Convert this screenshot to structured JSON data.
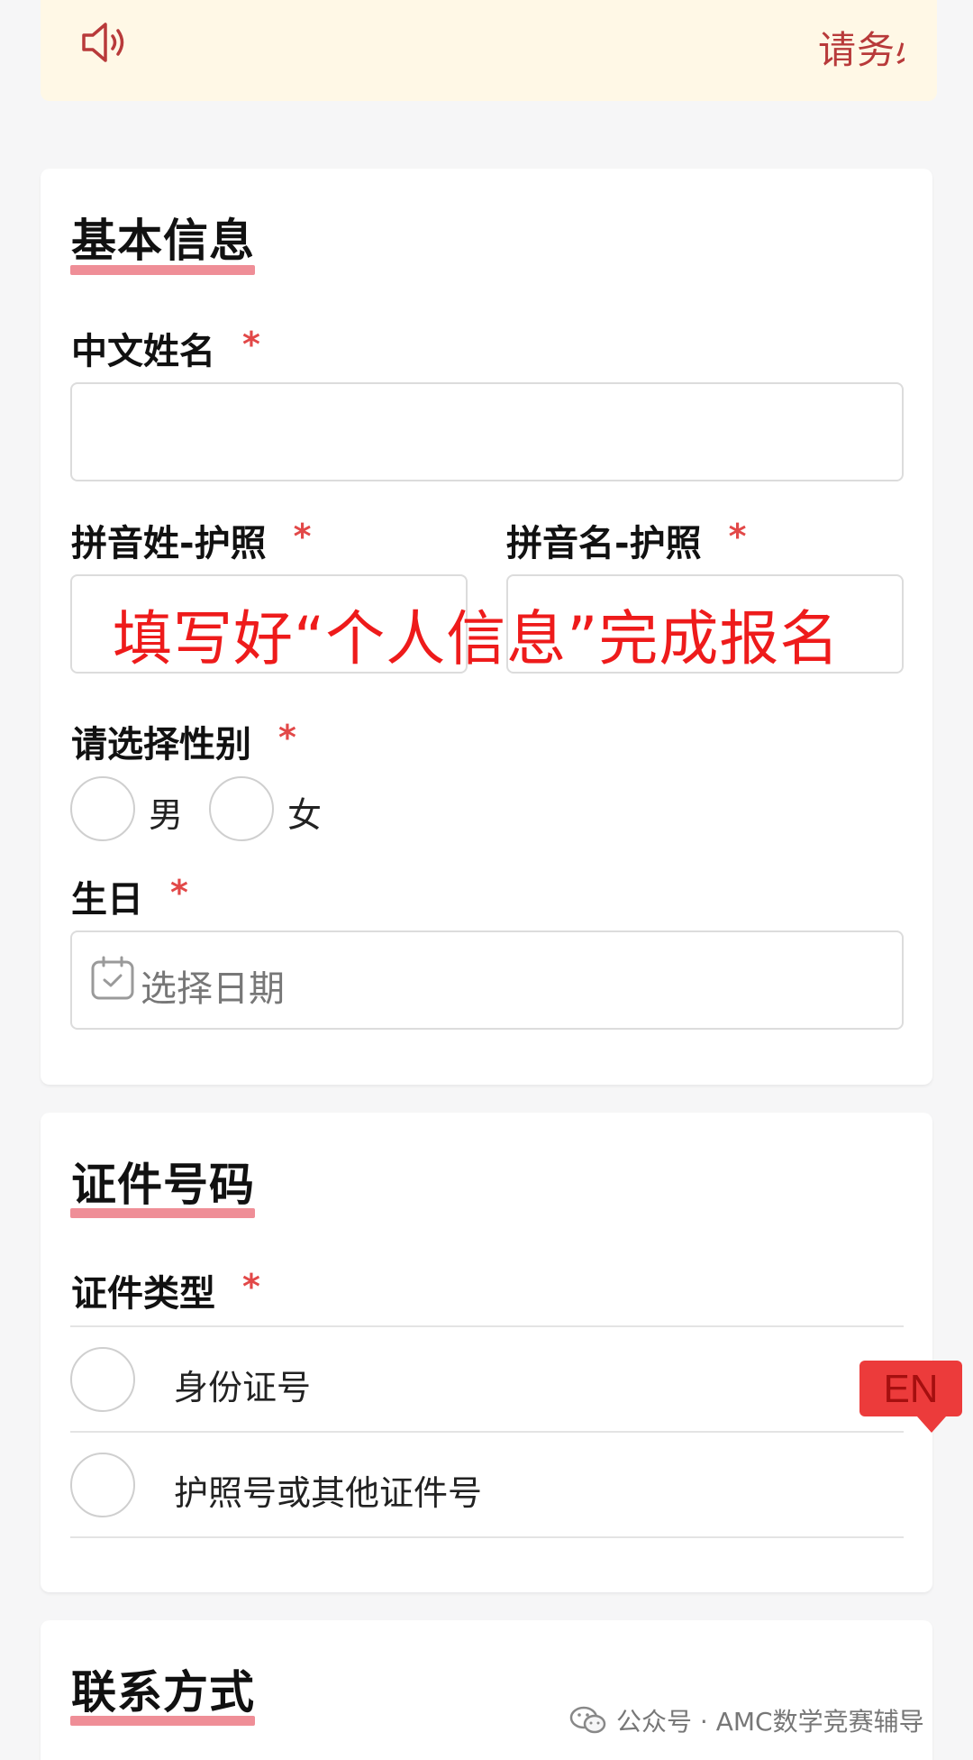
{
  "notice": {
    "text": "请务必"
  },
  "basic_info": {
    "title": "基本信息",
    "chinese_name_label": "中文姓名",
    "required_mark": "*",
    "pinyin_surname_label": "拼音姓-护照",
    "pinyin_given_label": "拼音名-护照",
    "gender_label": "请选择性别",
    "gender_options": [
      "男",
      "女"
    ],
    "birthday_label": "生日",
    "birthday_placeholder": "选择日期"
  },
  "overlay_text": "填写好“个人信息”完成报名",
  "id_section": {
    "title": "证件号码",
    "type_label": "证件类型",
    "options": [
      "身份证号",
      "护照号或其他证件号"
    ]
  },
  "contact_section": {
    "title": "联系方式"
  },
  "language_badge": "EN",
  "watermark": "公众号 · AMC数学竞赛辅导",
  "colors": {
    "accent_underline": "#ef8e97",
    "required": "#e24848",
    "overlay": "#ee1b1b",
    "badge": "#ec3b3b",
    "notice_bg": "#fff8e6"
  }
}
